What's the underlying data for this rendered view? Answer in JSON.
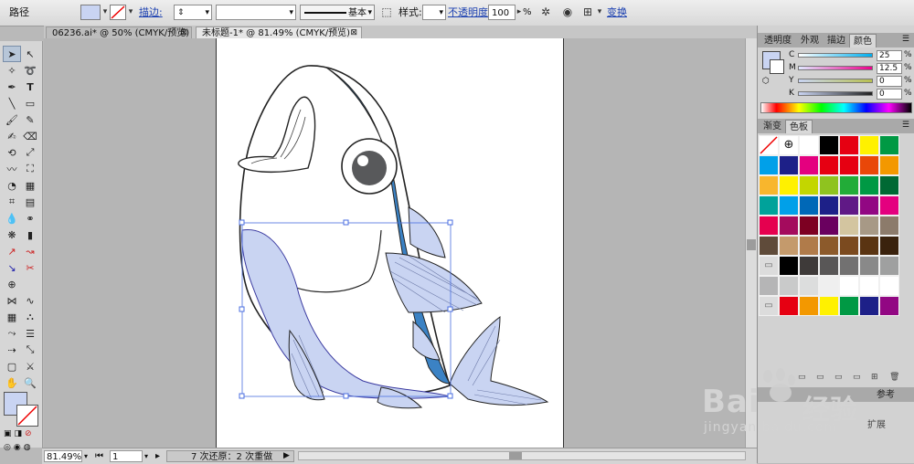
{
  "control_bar": {
    "object_type": "路径",
    "stroke_label": "描边:",
    "stroke_profile": "基本",
    "style_label": "样式:",
    "opacity_label": "不透明度:",
    "opacity_value": "100",
    "opacity_unit": "%",
    "transform_label": "变换",
    "fill_color": "#c9d4f2"
  },
  "document_tabs": [
    {
      "label": "06236.ai* @ 50% (CMYK/预览)",
      "active": false
    },
    {
      "label": "未标题-1* @ 81.49% (CMYK/预览)",
      "active": true
    }
  ],
  "status_bar": {
    "zoom": "81.49%",
    "page": "1",
    "history": "7 次还原：2 次重做"
  },
  "color_panel": {
    "tabs": [
      "透明度",
      "外观",
      "描边",
      "颜色"
    ],
    "active_tab": "颜色",
    "channels": [
      {
        "label": "C",
        "value": "25"
      },
      {
        "label": "M",
        "value": "12.5"
      },
      {
        "label": "Y",
        "value": "0"
      },
      {
        "label": "K",
        "value": "0"
      }
    ],
    "unit": "%"
  },
  "swatches_panel": {
    "tabs": [
      "渐变",
      "色板"
    ],
    "active_tab": "色板",
    "colors": [
      "#ffffff",
      "#ffffff",
      "#ffffff",
      "#000000",
      "#e60012",
      "#fff100",
      "#009944",
      "#00a0e9",
      "#1d2088",
      "#e4007f",
      "#e60012",
      "#e60012",
      "#e94709",
      "#f39800",
      "#f8b62d",
      "#fff100",
      "#c3d600",
      "#8fc31f",
      "#22ac38",
      "#009944",
      "#006934",
      "#00a29a",
      "#00a0e9",
      "#0068b7",
      "#1d2088",
      "#601986",
      "#920783",
      "#e4007f",
      "#e5004f",
      "#a40b5d",
      "#7d0022",
      "#6a005f",
      "#d3c5a0",
      "#a79986",
      "#8c7b6b",
      "#5f4b3a",
      "#c49a6c",
      "#b07b4a",
      "#8c5a2b",
      "#7b4a1f",
      "#5a3412",
      "#3a220d",
      "#ffffff",
      "#000000",
      "#3e3a39",
      "#595757",
      "#727171",
      "#898989",
      "#9fa0a0",
      "#b5b5b6",
      "#c9caca",
      "#dcdddd",
      "#efefef",
      "#ffffff",
      "#ffffff",
      "#ffffff",
      "#ffffff",
      "#e60012",
      "#f39800",
      "#fff100",
      "#009944",
      "#1d2088",
      "#920783"
    ]
  },
  "watermark": {
    "brand_top": "Bai",
    "brand_mid": "经验",
    "url": "jingyan.baidu.com"
  },
  "panel_bottom": {
    "label_a": "扩展",
    "label_b": "参考"
  }
}
